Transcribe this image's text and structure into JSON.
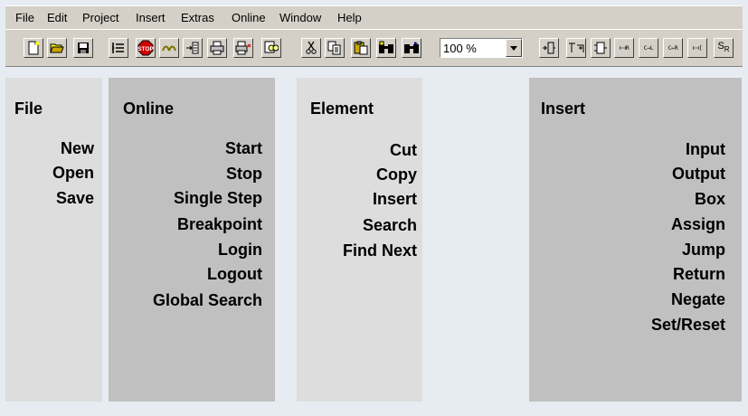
{
  "menu": [
    "File",
    "Edit",
    "Project",
    "Insert",
    "Extras",
    "Online",
    "Window",
    "Help"
  ],
  "toolbar": {
    "zoom_value": "100 %",
    "icons": [
      "new-document-icon",
      "open-folder-icon",
      "save-disk-icon",
      "step-list-icon",
      "stop-icon",
      "step-over-icon",
      "step-into-icon",
      "print-icon",
      "print-preview-icon",
      "find-icon",
      "cut-icon",
      "copy-icon",
      "paste-icon",
      "find-binoculars-icon",
      "find-next-icon",
      "insert-input-icon",
      "insert-box-icon",
      "insert-block-icon",
      "insert-coil-icon",
      "insert-contact-icon",
      "insert-negated-contact-icon",
      "insert-parallel-icon",
      "set-reset-icon"
    ],
    "labels": {
      "stop": "STOP",
      "coil": "⊢⊣R",
      "contact": "C→L",
      "neg_contact": "C←R",
      "parallel": "⊢⊣[",
      "set_reset_s": "S",
      "set_reset_r": "R"
    }
  },
  "panels": {
    "file": {
      "title": "File",
      "items": [
        "New",
        "Open",
        "Save"
      ]
    },
    "online": {
      "title": "Online",
      "items": [
        "Start",
        "Stop",
        "Single Step",
        "Breakpoint",
        "Login",
        "Logout",
        "Global Search"
      ]
    },
    "element": {
      "title": "Element",
      "items": [
        "Cut",
        "Copy",
        "Insert",
        "Search",
        "Find Next"
      ]
    },
    "insert": {
      "title": "Insert",
      "items": [
        "Input",
        "Output",
        "Box",
        "Assign",
        "Jump",
        "Return",
        "Negate",
        "Set/Reset"
      ]
    }
  }
}
